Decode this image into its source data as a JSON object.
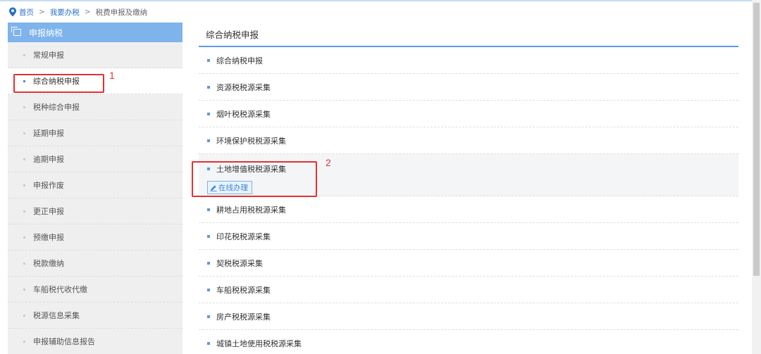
{
  "breadcrumb": {
    "home": "首页",
    "separator": ">",
    "level2": "我要办税",
    "current": "税费申报及缴纳"
  },
  "sidebar": {
    "title": "申报纳税",
    "items": [
      {
        "label": "常规申报"
      },
      {
        "label": "综合纳税申报",
        "active": true
      },
      {
        "label": "税种综合申报"
      },
      {
        "label": "延期申报"
      },
      {
        "label": "逾期申报"
      },
      {
        "label": "申报作废"
      },
      {
        "label": "更正申报"
      },
      {
        "label": "预缴申报"
      },
      {
        "label": "税款缴纳"
      },
      {
        "label": "车船税代收代缴"
      },
      {
        "label": "税源信息采集"
      },
      {
        "label": "申报辅助信息报告"
      }
    ]
  },
  "main": {
    "title": "综合纳税申报",
    "items": [
      {
        "label": "综合纳税申报"
      },
      {
        "label": "资源税税源采集"
      },
      {
        "label": "烟叶税税源采集"
      },
      {
        "label": "环境保护税税源采集"
      },
      {
        "label": "土地增值税税源采集",
        "expanded": true,
        "action": "在线办理"
      },
      {
        "label": "耕地占用税税源采集"
      },
      {
        "label": "印花税税源采集"
      },
      {
        "label": "契税税源采集"
      },
      {
        "label": "车船税税源采集"
      },
      {
        "label": "房产税税源采集"
      },
      {
        "label": "城镇土地使用税税源采集"
      }
    ]
  },
  "annotations": {
    "step1": "1",
    "step2": "2"
  },
  "colors": {
    "sidebar_header": "#7eb3ec",
    "accent": "#5b9ae0",
    "annotation": "#e33131"
  }
}
